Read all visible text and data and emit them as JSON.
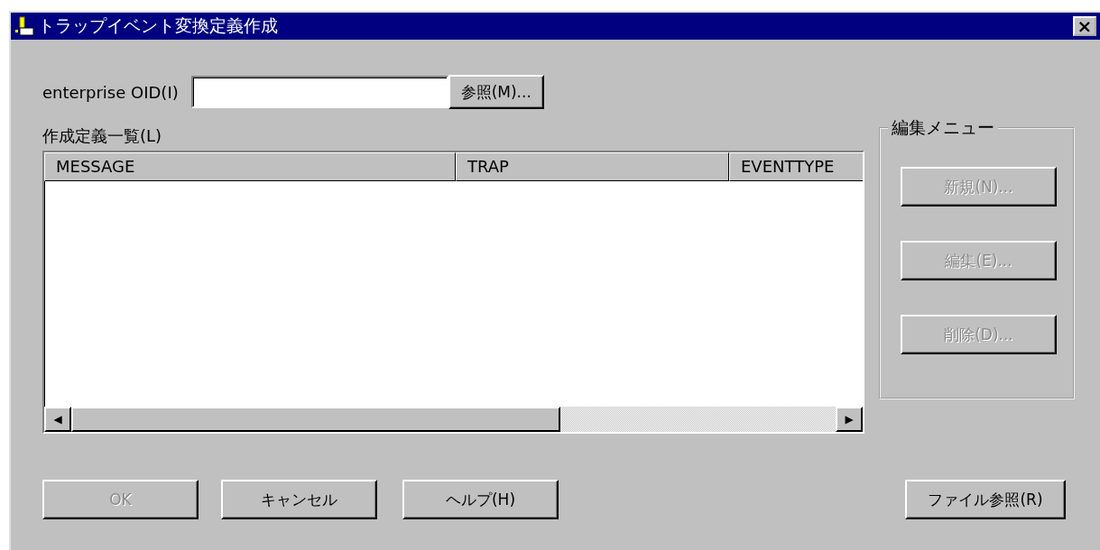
{
  "window": {
    "title": "トラップイベント変換定義作成",
    "close": "×"
  },
  "oid": {
    "label": "enterprise OID(I)",
    "browse": {
      "label": "参照(M)...",
      "disabled": false
    }
  },
  "list": {
    "label": "作成定義一覧(L)",
    "columns": [
      "MESSAGE",
      "TRAP",
      "EVENTTYPE"
    ],
    "scroll_left": "◀",
    "scroll_right": "▶"
  },
  "edit_menu": {
    "title": "編集メニュー",
    "buttons": [
      {
        "label": "新規(N)...",
        "disabled": true
      },
      {
        "label": "編集(E)...",
        "disabled": true
      },
      {
        "label": "削除(D)...",
        "disabled": true
      }
    ]
  },
  "buttons": [
    {
      "label": "OK",
      "disabled": true
    },
    {
      "label": "キャンセル",
      "disabled": false
    },
    {
      "label": "ヘルプ(H)",
      "disabled": false
    }
  ],
  "file_button": {
    "label": "ファイル参照(R)",
    "disabled": false
  }
}
